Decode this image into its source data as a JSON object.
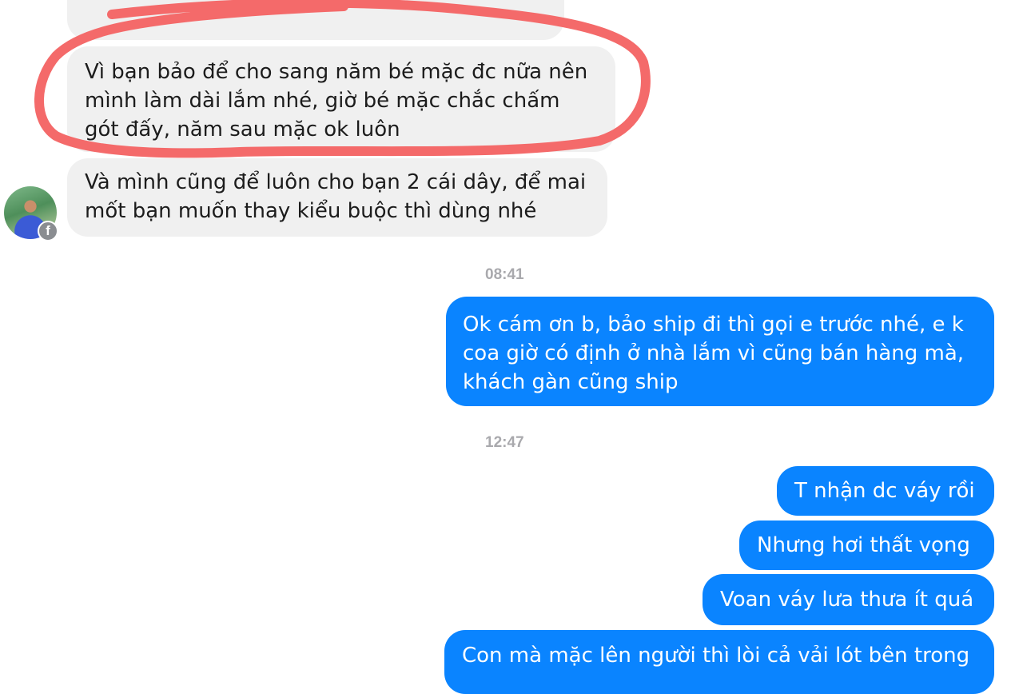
{
  "messages": {
    "incoming_highlighted": {
      "lines": [
        "Vì bạn bảo để cho sang năm bé mặc đc nữa nên",
        "mình làm dài lắm nhé, giờ bé mặc chắc chấm",
        "gót đấy, năm sau mặc ok luôn"
      ]
    },
    "incoming_second": {
      "lines": [
        "Và mình cũng để luôn cho bạn 2 cái dây, để mai",
        "mốt bạn muốn thay kiểu buộc thì dùng nhé"
      ]
    },
    "timestamp_1": "08:41",
    "outgoing_1": {
      "lines": [
        "Ok cám ơn b, bảo ship đi thì gọi e trước nhé, e k",
        "coa giờ có định ở nhà lắm vì cũng bán hàng mà,",
        "khách gàn cũng ship"
      ]
    },
    "timestamp_2": "12:47",
    "outgoing_2": "T nhận dc váy rồi",
    "outgoing_3": "Nhưng hơi thất vọng",
    "outgoing_4": "Voan váy lưa thưa ít quá",
    "outgoing_5_partial": "Con mà mặc lên người thì lòi cả vải lót bên trong"
  },
  "avatar_badge_icon": "facebook-icon",
  "colors": {
    "incoming_bubble": "#f0f0f0",
    "outgoing_bubble": "#0a84ff",
    "highlight_ring": "#f46a6a"
  }
}
